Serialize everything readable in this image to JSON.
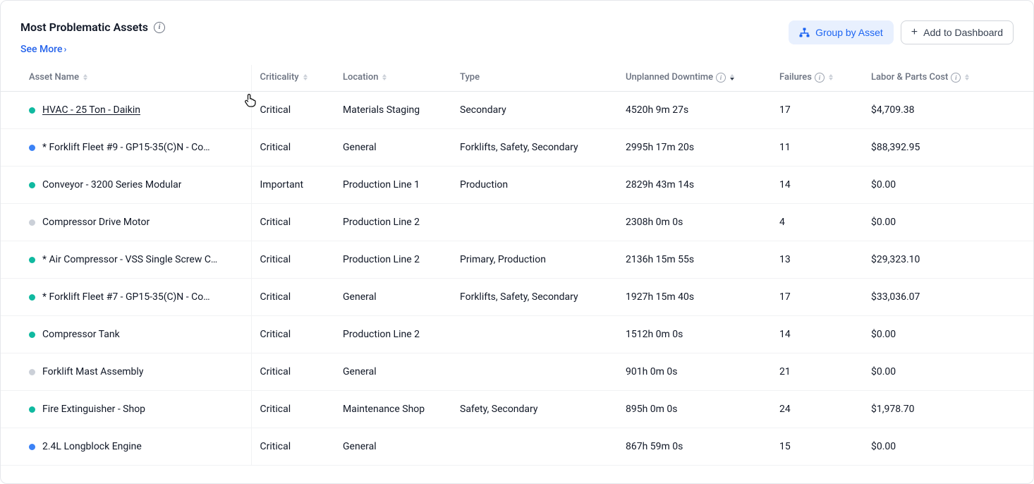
{
  "header": {
    "title": "Most Problematic Assets",
    "see_more": "See More"
  },
  "actions": {
    "group_by_asset": "Group by Asset",
    "add_to_dashboard": "Add to Dashboard"
  },
  "colors": {
    "teal": "#10b9a0",
    "blue": "#3b82f6",
    "gray": "#cbd0d8"
  },
  "columns": {
    "asset_name": "Asset Name",
    "criticality": "Criticality",
    "location": "Location",
    "type": "Type",
    "unplanned_downtime": "Unplanned Downtime",
    "failures": "Failures",
    "labor_parts_cost": "Labor & Parts Cost"
  },
  "rows": [
    {
      "color_key": "teal",
      "name": "HVAC - 25 Ton - Daikin",
      "linked": true,
      "criticality": "Critical",
      "location": "Materials Staging",
      "type": "Secondary",
      "downtime": "4520h 9m 27s",
      "failures": "17",
      "cost": "$4,709.38"
    },
    {
      "color_key": "blue",
      "name": "* Forklift Fleet #9 - GP15-35(C)N - Co…",
      "linked": false,
      "criticality": "Critical",
      "location": "General",
      "type": "Forklifts, Safety, Secondary",
      "downtime": "2995h 17m 20s",
      "failures": "11",
      "cost": "$88,392.95"
    },
    {
      "color_key": "teal",
      "name": "Conveyor - 3200 Series Modular",
      "linked": false,
      "criticality": "Important",
      "location": "Production Line 1",
      "type": "Production",
      "downtime": "2829h 43m 14s",
      "failures": "14",
      "cost": "$0.00"
    },
    {
      "color_key": "gray",
      "name": "Compressor Drive Motor",
      "linked": false,
      "criticality": "Critical",
      "location": "Production Line 2",
      "type": "",
      "downtime": "2308h 0m 0s",
      "failures": "4",
      "cost": "$0.00"
    },
    {
      "color_key": "teal",
      "name": "* Air Compressor - VSS Single Screw C…",
      "linked": false,
      "criticality": "Critical",
      "location": "Production Line 2",
      "type": "Primary, Production",
      "downtime": "2136h 15m 55s",
      "failures": "13",
      "cost": "$29,323.10"
    },
    {
      "color_key": "teal",
      "name": "* Forklift Fleet #7 - GP15-35(C)N - Co…",
      "linked": false,
      "criticality": "Critical",
      "location": "General",
      "type": "Forklifts, Safety, Secondary",
      "downtime": "1927h 15m 40s",
      "failures": "17",
      "cost": "$33,036.07"
    },
    {
      "color_key": "teal",
      "name": "Compressor Tank",
      "linked": false,
      "criticality": "Critical",
      "location": "Production Line 2",
      "type": "",
      "downtime": "1512h 0m 0s",
      "failures": "14",
      "cost": "$0.00"
    },
    {
      "color_key": "gray",
      "name": "Forklift Mast Assembly",
      "linked": false,
      "criticality": "Critical",
      "location": "General",
      "type": "",
      "downtime": "901h 0m 0s",
      "failures": "21",
      "cost": "$0.00"
    },
    {
      "color_key": "teal",
      "name": "Fire Extinguisher - Shop",
      "linked": false,
      "criticality": "Critical",
      "location": "Maintenance Shop",
      "type": "Safety, Secondary",
      "downtime": "895h 0m 0s",
      "failures": "24",
      "cost": "$1,978.70"
    },
    {
      "color_key": "blue",
      "name": "2.4L Longblock Engine",
      "linked": false,
      "criticality": "Critical",
      "location": "General",
      "type": "",
      "downtime": "867h 59m 0s",
      "failures": "15",
      "cost": "$0.00"
    }
  ]
}
